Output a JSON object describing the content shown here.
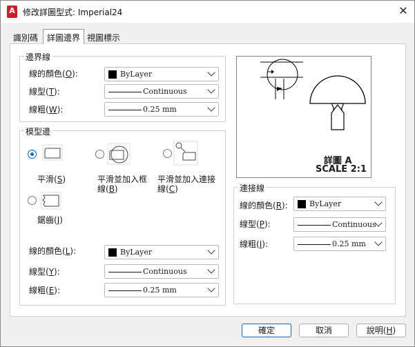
{
  "window": {
    "title": "修改詳圖型式: Imperial24",
    "app_icon_letter": "A"
  },
  "tabs": [
    {
      "label": "識別碼"
    },
    {
      "label": "詳圖邊界"
    },
    {
      "label": "視圖標示"
    }
  ],
  "boundary": {
    "title": "邊界線",
    "color_label": "線的顏色(",
    "color_key": "O",
    "color_value": "ByLayer",
    "type_label": "線型(",
    "type_key": "T",
    "type_value": "Continuous",
    "weight_label": "線粗(",
    "weight_key": "W",
    "weight_value": "0.25 mm"
  },
  "model_edge": {
    "title": "模型邊",
    "options": [
      {
        "label": "平滑(",
        "key": "S"
      },
      {
        "label_1": "平滑並加入框",
        "label_2": "線(",
        "key": "B"
      },
      {
        "label_1": "平滑並加入連接",
        "label_2": "線(",
        "key": "C"
      },
      {
        "label": "鋸齒(",
        "key": "J"
      }
    ],
    "color_label": "線的顏色(",
    "color_key": "L",
    "color_value": "ByLayer",
    "type_label": "線型(",
    "type_key": "Y",
    "type_value": "Continuous",
    "weight_label": "線粗(",
    "weight_key": "E",
    "weight_value": "0.25 mm"
  },
  "preview": {
    "caption_1": "詳圖 A",
    "caption_2": "SCALE 2:1"
  },
  "connector": {
    "title": "連接線",
    "color_label": "線的顏色(",
    "color_key": "R",
    "color_value": "ByLayer",
    "type_label": "線型(",
    "type_key": "P",
    "type_value": "Continuous",
    "weight_label": "線粗(",
    "weight_key": "I",
    "weight_value": "0.25 mm"
  },
  "buttons": {
    "ok": "確定",
    "cancel": "取消",
    "help_label": "說明(",
    "help_key": "H"
  },
  "common": {
    "close_paren": ")"
  }
}
